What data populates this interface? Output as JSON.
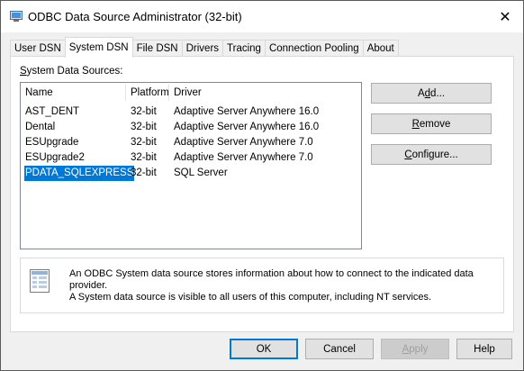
{
  "window": {
    "title": "ODBC Data Source Administrator (32-bit)",
    "close_glyph": "✕"
  },
  "tabs": [
    {
      "label": "User DSN",
      "active": false
    },
    {
      "label": "System DSN",
      "active": true
    },
    {
      "label": "File DSN",
      "active": false
    },
    {
      "label": "Drivers",
      "active": false
    },
    {
      "label": "Tracing",
      "active": false
    },
    {
      "label": "Connection Pooling",
      "active": false
    },
    {
      "label": "About",
      "active": false
    }
  ],
  "panel": {
    "section_label_first": "S",
    "section_label_rest": "ystem Data Sources:",
    "columns": {
      "name": "Name",
      "platform": "Platform",
      "driver": "Driver"
    },
    "rows": [
      {
        "name": "AST_DENT",
        "platform": "32-bit",
        "driver": "Adaptive Server Anywhere 16.0",
        "selected": false
      },
      {
        "name": "Dental",
        "platform": "32-bit",
        "driver": "Adaptive Server Anywhere 16.0",
        "selected": false
      },
      {
        "name": "ESUpgrade",
        "platform": "32-bit",
        "driver": "Adaptive Server Anywhere 7.0",
        "selected": false
      },
      {
        "name": "ESUpgrade2",
        "platform": "32-bit",
        "driver": "Adaptive Server Anywhere 7.0",
        "selected": false
      },
      {
        "name": "PDATA_SQLEXPRESS",
        "platform": "32-bit",
        "driver": "SQL Server",
        "selected": true
      }
    ],
    "buttons": {
      "add": {
        "pre": "A",
        "u": "d",
        "post": "d..."
      },
      "remove": {
        "pre": "",
        "u": "R",
        "post": "emove"
      },
      "configure": {
        "pre": "",
        "u": "C",
        "post": "onfigure..."
      }
    },
    "info_text_1": "An ODBC System data source stores information about how to connect to the indicated data provider.",
    "info_text_2": "A System data source is visible to all users of this computer, including NT services."
  },
  "footer": {
    "ok": "OK",
    "cancel": "Cancel",
    "apply_u": "A",
    "apply_rest": "pply",
    "help": "Help"
  },
  "colors": {
    "selection": "#0078d7",
    "default_button_border": "#0078d7"
  }
}
